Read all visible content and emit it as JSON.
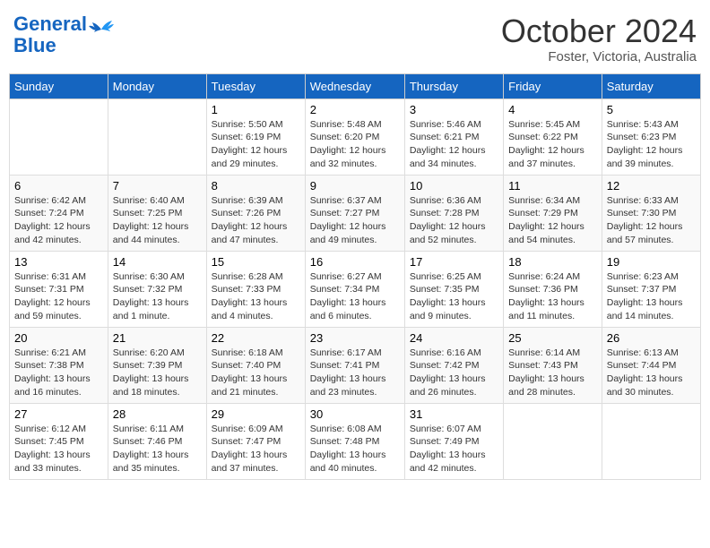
{
  "header": {
    "logo_line1": "General",
    "logo_line2": "Blue",
    "month": "October 2024",
    "location": "Foster, Victoria, Australia"
  },
  "days_of_week": [
    "Sunday",
    "Monday",
    "Tuesday",
    "Wednesday",
    "Thursday",
    "Friday",
    "Saturday"
  ],
  "weeks": [
    [
      {
        "day": "",
        "info": ""
      },
      {
        "day": "",
        "info": ""
      },
      {
        "day": "1",
        "info": "Sunrise: 5:50 AM\nSunset: 6:19 PM\nDaylight: 12 hours and 29 minutes."
      },
      {
        "day": "2",
        "info": "Sunrise: 5:48 AM\nSunset: 6:20 PM\nDaylight: 12 hours and 32 minutes."
      },
      {
        "day": "3",
        "info": "Sunrise: 5:46 AM\nSunset: 6:21 PM\nDaylight: 12 hours and 34 minutes."
      },
      {
        "day": "4",
        "info": "Sunrise: 5:45 AM\nSunset: 6:22 PM\nDaylight: 12 hours and 37 minutes."
      },
      {
        "day": "5",
        "info": "Sunrise: 5:43 AM\nSunset: 6:23 PM\nDaylight: 12 hours and 39 minutes."
      }
    ],
    [
      {
        "day": "6",
        "info": "Sunrise: 6:42 AM\nSunset: 7:24 PM\nDaylight: 12 hours and 42 minutes."
      },
      {
        "day": "7",
        "info": "Sunrise: 6:40 AM\nSunset: 7:25 PM\nDaylight: 12 hours and 44 minutes."
      },
      {
        "day": "8",
        "info": "Sunrise: 6:39 AM\nSunset: 7:26 PM\nDaylight: 12 hours and 47 minutes."
      },
      {
        "day": "9",
        "info": "Sunrise: 6:37 AM\nSunset: 7:27 PM\nDaylight: 12 hours and 49 minutes."
      },
      {
        "day": "10",
        "info": "Sunrise: 6:36 AM\nSunset: 7:28 PM\nDaylight: 12 hours and 52 minutes."
      },
      {
        "day": "11",
        "info": "Sunrise: 6:34 AM\nSunset: 7:29 PM\nDaylight: 12 hours and 54 minutes."
      },
      {
        "day": "12",
        "info": "Sunrise: 6:33 AM\nSunset: 7:30 PM\nDaylight: 12 hours and 57 minutes."
      }
    ],
    [
      {
        "day": "13",
        "info": "Sunrise: 6:31 AM\nSunset: 7:31 PM\nDaylight: 12 hours and 59 minutes."
      },
      {
        "day": "14",
        "info": "Sunrise: 6:30 AM\nSunset: 7:32 PM\nDaylight: 13 hours and 1 minute."
      },
      {
        "day": "15",
        "info": "Sunrise: 6:28 AM\nSunset: 7:33 PM\nDaylight: 13 hours and 4 minutes."
      },
      {
        "day": "16",
        "info": "Sunrise: 6:27 AM\nSunset: 7:34 PM\nDaylight: 13 hours and 6 minutes."
      },
      {
        "day": "17",
        "info": "Sunrise: 6:25 AM\nSunset: 7:35 PM\nDaylight: 13 hours and 9 minutes."
      },
      {
        "day": "18",
        "info": "Sunrise: 6:24 AM\nSunset: 7:36 PM\nDaylight: 13 hours and 11 minutes."
      },
      {
        "day": "19",
        "info": "Sunrise: 6:23 AM\nSunset: 7:37 PM\nDaylight: 13 hours and 14 minutes."
      }
    ],
    [
      {
        "day": "20",
        "info": "Sunrise: 6:21 AM\nSunset: 7:38 PM\nDaylight: 13 hours and 16 minutes."
      },
      {
        "day": "21",
        "info": "Sunrise: 6:20 AM\nSunset: 7:39 PM\nDaylight: 13 hours and 18 minutes."
      },
      {
        "day": "22",
        "info": "Sunrise: 6:18 AM\nSunset: 7:40 PM\nDaylight: 13 hours and 21 minutes."
      },
      {
        "day": "23",
        "info": "Sunrise: 6:17 AM\nSunset: 7:41 PM\nDaylight: 13 hours and 23 minutes."
      },
      {
        "day": "24",
        "info": "Sunrise: 6:16 AM\nSunset: 7:42 PM\nDaylight: 13 hours and 26 minutes."
      },
      {
        "day": "25",
        "info": "Sunrise: 6:14 AM\nSunset: 7:43 PM\nDaylight: 13 hours and 28 minutes."
      },
      {
        "day": "26",
        "info": "Sunrise: 6:13 AM\nSunset: 7:44 PM\nDaylight: 13 hours and 30 minutes."
      }
    ],
    [
      {
        "day": "27",
        "info": "Sunrise: 6:12 AM\nSunset: 7:45 PM\nDaylight: 13 hours and 33 minutes."
      },
      {
        "day": "28",
        "info": "Sunrise: 6:11 AM\nSunset: 7:46 PM\nDaylight: 13 hours and 35 minutes."
      },
      {
        "day": "29",
        "info": "Sunrise: 6:09 AM\nSunset: 7:47 PM\nDaylight: 13 hours and 37 minutes."
      },
      {
        "day": "30",
        "info": "Sunrise: 6:08 AM\nSunset: 7:48 PM\nDaylight: 13 hours and 40 minutes."
      },
      {
        "day": "31",
        "info": "Sunrise: 6:07 AM\nSunset: 7:49 PM\nDaylight: 13 hours and 42 minutes."
      },
      {
        "day": "",
        "info": ""
      },
      {
        "day": "",
        "info": ""
      }
    ]
  ]
}
